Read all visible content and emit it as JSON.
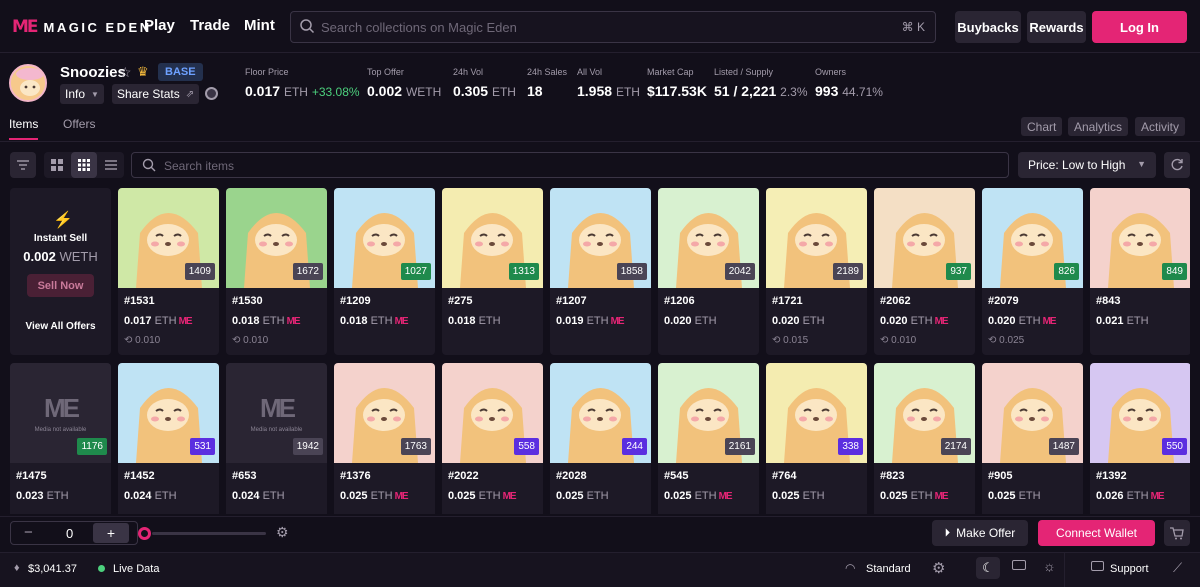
{
  "brand": {
    "mark": "ME",
    "name": "MAGIC EDEN"
  },
  "nav": {
    "play": "Play",
    "trade": "Trade",
    "mint": "Mint"
  },
  "search": {
    "placeholder": "Search collections on Magic Eden",
    "shortcut": "⌘ K"
  },
  "header_buttons": {
    "buybacks": "Buybacks",
    "rewards": "Rewards",
    "login": "Log In"
  },
  "collection": {
    "name": "Snoozies",
    "chain_badge": "BASE",
    "info_label": "Info",
    "share_label": "Share Stats",
    "stats": [
      {
        "label": "Floor Price",
        "value": "0.017",
        "unit": "ETH",
        "extra": "+33.08%"
      },
      {
        "label": "Top Offer",
        "value": "0.002",
        "unit": "WETH",
        "extra": ""
      },
      {
        "label": "24h Vol",
        "value": "0.305",
        "unit": "ETH",
        "extra": ""
      },
      {
        "label": "24h Sales",
        "value": "18",
        "unit": "",
        "extra": ""
      },
      {
        "label": "All Vol",
        "value": "1.958",
        "unit": "ETH",
        "extra": ""
      },
      {
        "label": "Market Cap",
        "value": "$117.53K",
        "unit": "",
        "extra": ""
      },
      {
        "label": "Listed / Supply",
        "value": "51 / 2,221",
        "unit": "2.3%",
        "extra": ""
      },
      {
        "label": "Owners",
        "value": "993",
        "unit": "44.71%",
        "extra": ""
      }
    ]
  },
  "tabs": {
    "items": "Items",
    "offers": "Offers"
  },
  "right_tabs": {
    "chart": "Chart",
    "analytics": "Analytics",
    "activity": "Activity"
  },
  "toolbar": {
    "search_placeholder": "Search items",
    "sort": "Price: Low to High"
  },
  "instant_sell": {
    "title": "Instant Sell",
    "value": "0.002",
    "unit": "WETH",
    "button": "Sell Now",
    "link": "View All Offers"
  },
  "colors": {
    "accent": "#e42575",
    "rank_green": "#1f8a4c",
    "rank_purple": "#5b2ee0",
    "rank_gray": "#4a4455"
  },
  "cards_row1": [
    {
      "id": "#1531",
      "rank": "1409",
      "rank_color": "gray",
      "price": "0.017",
      "unit": "ETH",
      "me": true,
      "last": "0.010",
      "bg": "#cfe8a6"
    },
    {
      "id": "#1530",
      "rank": "1672",
      "rank_color": "gray",
      "price": "0.018",
      "unit": "ETH",
      "me": true,
      "last": "0.010",
      "bg": "#9ad48d"
    },
    {
      "id": "#1209",
      "rank": "1027",
      "rank_color": "green",
      "price": "0.018",
      "unit": "ETH",
      "me": true,
      "last": "",
      "bg": "#bfe3f4"
    },
    {
      "id": "#275",
      "rank": "1313",
      "rank_color": "green",
      "price": "0.018",
      "unit": "ETH",
      "me": false,
      "last": "",
      "bg": "#f4ecb0"
    },
    {
      "id": "#1207",
      "rank": "1858",
      "rank_color": "gray",
      "price": "0.019",
      "unit": "ETH",
      "me": true,
      "last": "",
      "bg": "#bfe3f4"
    },
    {
      "id": "#1206",
      "rank": "2042",
      "rank_color": "gray",
      "price": "0.020",
      "unit": "ETH",
      "me": false,
      "last": "",
      "bg": "#d8f1d0"
    },
    {
      "id": "#1721",
      "rank": "2189",
      "rank_color": "gray",
      "price": "0.020",
      "unit": "ETH",
      "me": false,
      "last": "0.015",
      "bg": "#f5eeb5"
    },
    {
      "id": "#2062",
      "rank": "937",
      "rank_color": "green",
      "price": "0.020",
      "unit": "ETH",
      "me": true,
      "last": "0.010",
      "bg": "#f4dfc5"
    },
    {
      "id": "#2079",
      "rank": "826",
      "rank_color": "green",
      "price": "0.020",
      "unit": "ETH",
      "me": true,
      "last": "0.025",
      "bg": "#bfe3f4"
    },
    {
      "id": "#843",
      "rank": "849",
      "rank_color": "green",
      "price": "0.021",
      "unit": "ETH",
      "me": false,
      "last": "",
      "bg": "#f4d2cc"
    }
  ],
  "cards_row2": [
    {
      "id": "#1475",
      "rank": "1176",
      "rank_color": "green",
      "price": "0.023",
      "unit": "ETH",
      "me": false,
      "bg": "#2a2533",
      "na": true
    },
    {
      "id": "#1452",
      "rank": "531",
      "rank_color": "purple",
      "price": "0.024",
      "unit": "ETH",
      "me": false,
      "bg": "#bfe3f4",
      "na": false
    },
    {
      "id": "#653",
      "rank": "1942",
      "rank_color": "gray",
      "price": "0.024",
      "unit": "ETH",
      "me": false,
      "bg": "#2a2533",
      "na": true
    },
    {
      "id": "#1376",
      "rank": "1763",
      "rank_color": "gray",
      "price": "0.025",
      "unit": "ETH",
      "me": true,
      "bg": "#f4d2cc",
      "na": false
    },
    {
      "id": "#2022",
      "rank": "558",
      "rank_color": "purple",
      "price": "0.025",
      "unit": "ETH",
      "me": true,
      "bg": "#f4d2cc",
      "na": false
    },
    {
      "id": "#2028",
      "rank": "244",
      "rank_color": "purple",
      "price": "0.025",
      "unit": "ETH",
      "me": false,
      "bg": "#bfe3f4",
      "na": false
    },
    {
      "id": "#545",
      "rank": "2161",
      "rank_color": "gray",
      "price": "0.025",
      "unit": "ETH",
      "me": true,
      "bg": "#d8f1d0",
      "na": false
    },
    {
      "id": "#764",
      "rank": "338",
      "rank_color": "purple",
      "price": "0.025",
      "unit": "ETH",
      "me": false,
      "bg": "#f4ecb0",
      "na": false
    },
    {
      "id": "#823",
      "rank": "2174",
      "rank_color": "gray",
      "price": "0.025",
      "unit": "ETH",
      "me": true,
      "bg": "#d8f1d0",
      "na": false
    },
    {
      "id": "#905",
      "rank": "1487",
      "rank_color": "gray",
      "price": "0.025",
      "unit": "ETH",
      "me": false,
      "bg": "#f4d2cc",
      "na": false
    },
    {
      "id": "#1392",
      "rank": "550",
      "rank_color": "purple",
      "price": "0.026",
      "unit": "ETH",
      "me": true,
      "bg": "#d6c7f2",
      "na": false
    }
  ],
  "media_na": "Media not available",
  "bottom": {
    "qty": "0",
    "make_offer": "Make Offer",
    "connect": "Connect Wallet"
  },
  "status": {
    "eth_price": "$3,041.37",
    "live": "Live Data",
    "standard": "Standard",
    "support": "Support"
  }
}
